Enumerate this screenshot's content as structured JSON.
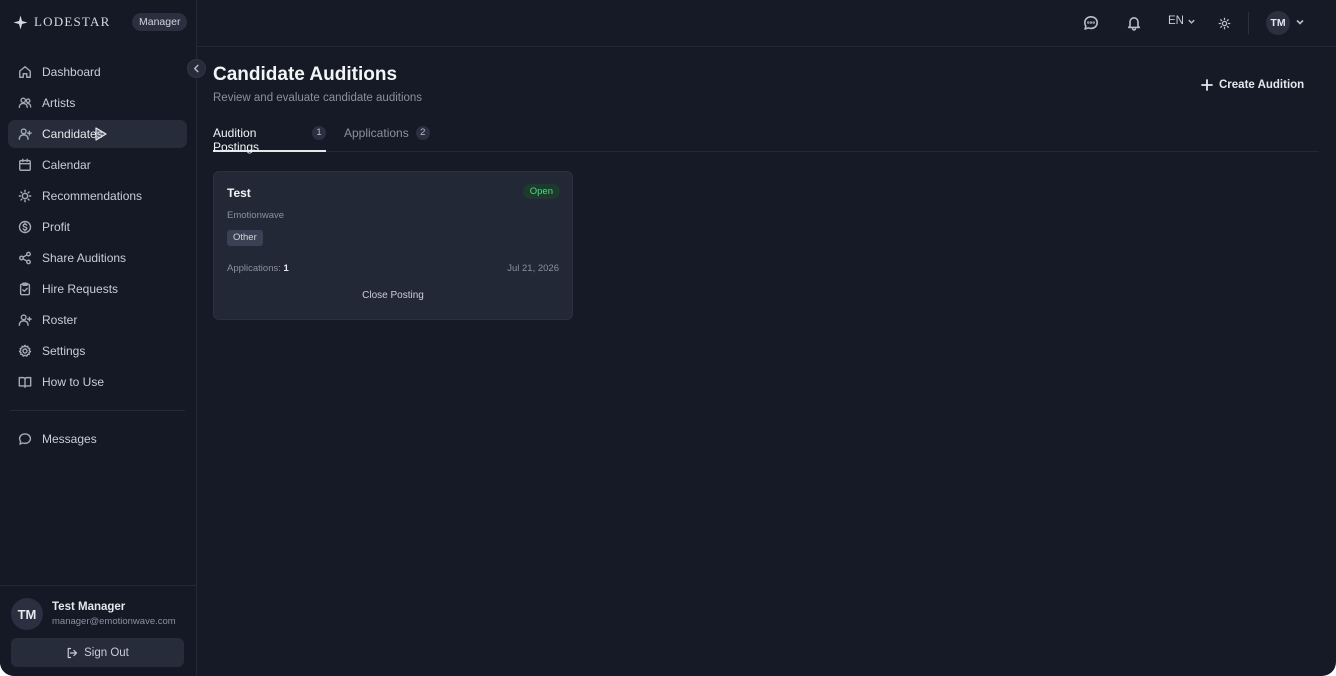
{
  "brand": {
    "name": "LODESTAR",
    "role": "Manager",
    "star_icon": "sparkle-icon"
  },
  "sidebar": {
    "items": [
      {
        "label": "Dashboard",
        "icon": "home-icon"
      },
      {
        "label": "Artists",
        "icon": "users-icon"
      },
      {
        "label": "Candidates",
        "icon": "user-plus-icon",
        "active": true
      },
      {
        "label": "Calendar",
        "icon": "calendar-icon"
      },
      {
        "label": "Recommendations",
        "icon": "lightbulb-icon"
      },
      {
        "label": "Profit",
        "icon": "dollar-icon"
      },
      {
        "label": "Share Auditions",
        "icon": "share-icon"
      },
      {
        "label": "Hire Requests",
        "icon": "clipboard-icon"
      },
      {
        "label": "Roster",
        "icon": "user-plus-icon"
      },
      {
        "label": "Settings",
        "icon": "gear-icon"
      },
      {
        "label": "How to Use",
        "icon": "book-icon"
      }
    ],
    "messages": {
      "label": "Messages",
      "icon": "message-icon"
    }
  },
  "user": {
    "initials": "TM",
    "name": "Test Manager",
    "email": "manager@emotionwave.com",
    "sign_out": "Sign Out"
  },
  "topbar": {
    "language": "EN",
    "initials": "TM"
  },
  "page": {
    "title": "Candidate Auditions",
    "subtitle": "Review and evaluate candidate auditions",
    "create_label": "Create Audition"
  },
  "tabs": [
    {
      "label": "Audition Postings",
      "count": "1",
      "active": true
    },
    {
      "label": "Applications",
      "count": "2",
      "active": false
    }
  ],
  "card": {
    "title": "Test",
    "status": "Open",
    "organization": "Emotionwave",
    "tag": "Other",
    "applications_label": "Applications:",
    "applications_count": "1",
    "date": "Jul 21, 2026",
    "close_label": "Close Posting"
  },
  "colors": {
    "background": "#151a26",
    "sidebar": "#141925",
    "card": "#232837",
    "open_status": "#4ade80"
  }
}
